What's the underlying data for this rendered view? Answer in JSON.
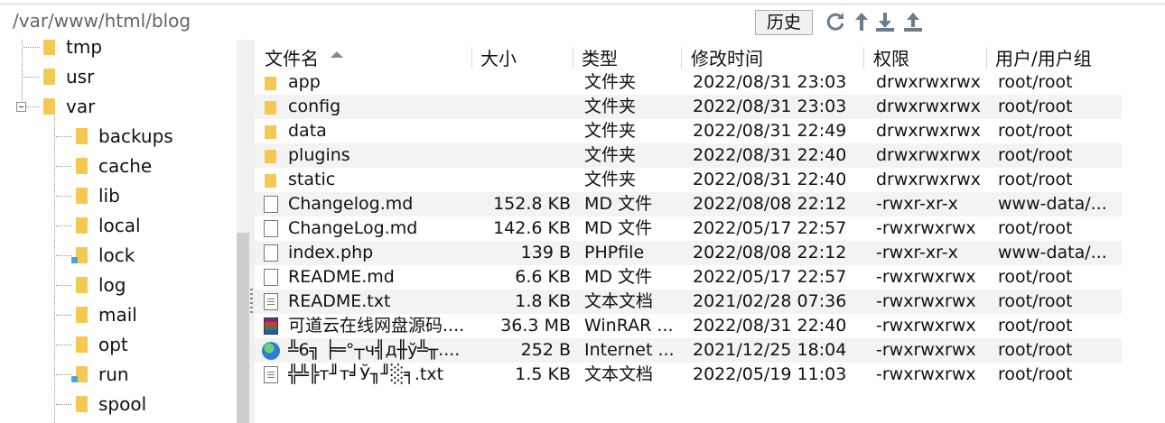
{
  "path_bar": {
    "value": "/var/www/html/blog",
    "history_label": "历史"
  },
  "toolbar_icons": [
    "refresh-icon",
    "up-icon",
    "download-icon",
    "upload-icon"
  ],
  "tree": {
    "items": [
      {
        "label": "tmp",
        "level": 1
      },
      {
        "label": "usr",
        "level": 1
      },
      {
        "label": "var",
        "level": 1,
        "expanded": true
      },
      {
        "label": "backups",
        "level": 2
      },
      {
        "label": "cache",
        "level": 2
      },
      {
        "label": "lib",
        "level": 2
      },
      {
        "label": "local",
        "level": 2
      },
      {
        "label": "lock",
        "level": 2,
        "link": true
      },
      {
        "label": "log",
        "level": 2
      },
      {
        "label": "mail",
        "level": 2
      },
      {
        "label": "opt",
        "level": 2
      },
      {
        "label": "run",
        "level": 2,
        "link": true
      },
      {
        "label": "spool",
        "level": 2
      }
    ]
  },
  "list": {
    "columns": {
      "name": "文件名",
      "size": "大小",
      "type": "类型",
      "modified": "修改时间",
      "perm": "权限",
      "owner": "用户/用户组"
    },
    "rows": [
      {
        "icon": "folder-icon",
        "name": "app",
        "size": "",
        "type": "文件夹",
        "modified": "2022/08/31 23:03",
        "perm": "drwxrwxrwx",
        "owner": "root/root"
      },
      {
        "icon": "folder-icon",
        "name": "config",
        "size": "",
        "type": "文件夹",
        "modified": "2022/08/31 23:03",
        "perm": "drwxrwxrwx",
        "owner": "root/root"
      },
      {
        "icon": "folder-icon",
        "name": "data",
        "size": "",
        "type": "文件夹",
        "modified": "2022/08/31 22:49",
        "perm": "drwxrwxrwx",
        "owner": "root/root"
      },
      {
        "icon": "folder-icon",
        "name": "plugins",
        "size": "",
        "type": "文件夹",
        "modified": "2022/08/31 22:40",
        "perm": "drwxrwxrwx",
        "owner": "root/root"
      },
      {
        "icon": "folder-icon",
        "name": "static",
        "size": "",
        "type": "文件夹",
        "modified": "2022/08/31 22:40",
        "perm": "drwxrwxrwx",
        "owner": "root/root"
      },
      {
        "icon": "file-icon",
        "name": "Changelog.md",
        "size": "152.8 KB",
        "type": "MD 文件",
        "modified": "2022/08/08 22:12",
        "perm": "-rwxr-xr-x",
        "owner": "www-data/..."
      },
      {
        "icon": "file-icon",
        "name": "ChangeLog.md",
        "size": "142.6 KB",
        "type": "MD 文件",
        "modified": "2022/05/17 22:57",
        "perm": "-rwxrwxrwx",
        "owner": "root/root"
      },
      {
        "icon": "file-icon",
        "name": "index.php",
        "size": "139 B",
        "type": "PHPfile",
        "modified": "2022/08/08 22:12",
        "perm": "-rwxr-xr-x",
        "owner": "www-data/..."
      },
      {
        "icon": "file-icon",
        "name": "README.md",
        "size": "6.6 KB",
        "type": "MD 文件",
        "modified": "2022/05/17 22:57",
        "perm": "-rwxrwxrwx",
        "owner": "root/root"
      },
      {
        "icon": "text-file-icon",
        "name": "README.txt",
        "size": "1.8 KB",
        "type": "文本文档",
        "modified": "2021/02/28 07:36",
        "perm": "-rwxrwxrwx",
        "owner": "root/root"
      },
      {
        "icon": "winrar-archive-icon",
        "name": "可道云在线网盘源码....",
        "size": "36.3 MB",
        "type": "WinRAR ...",
        "modified": "2022/08/31 22:40",
        "perm": "-rwxrwxrwx",
        "owner": "root/root"
      },
      {
        "icon": "internet-shortcut-icon",
        "name": "╩6╗ ╞═°┬ч╣д╫ў╩╥....",
        "size": "252 B",
        "type": "Internet ...",
        "modified": "2021/12/25 18:04",
        "perm": "-rwxrwxrwx",
        "owner": "root/root"
      },
      {
        "icon": "text-file-icon",
        "name": "╬╩╠т╜т╛Ў╖╜░╕.txt",
        "size": "1.5 KB",
        "type": "文本文档",
        "modified": "2022/05/19 11:03",
        "perm": "-rwxrwxrwx",
        "owner": "root/root"
      }
    ]
  }
}
